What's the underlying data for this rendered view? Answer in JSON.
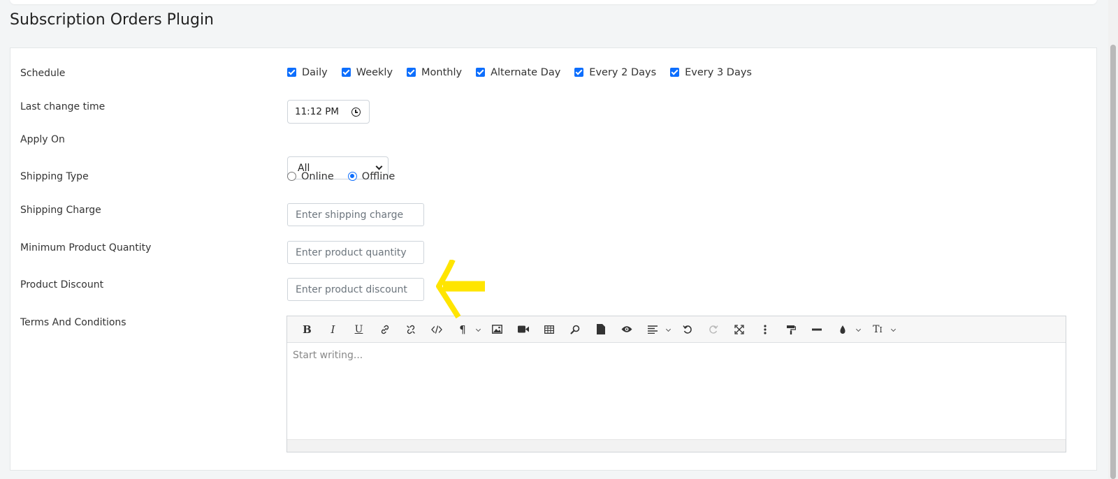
{
  "page": {
    "title": "Subscription Orders Plugin"
  },
  "form": {
    "schedule": {
      "label": "Schedule",
      "options": [
        {
          "label": "Daily",
          "checked": true
        },
        {
          "label": "Weekly",
          "checked": true
        },
        {
          "label": "Monthly",
          "checked": true
        },
        {
          "label": "Alternate Day",
          "checked": true
        },
        {
          "label": "Every 2 Days",
          "checked": true
        },
        {
          "label": "Every 3 Days",
          "checked": true
        }
      ]
    },
    "last_change_time": {
      "label": "Last change time",
      "value": "11:12 PM"
    },
    "apply_on": {
      "label": "Apply On",
      "value": "All"
    },
    "shipping_type": {
      "label": "Shipping Type",
      "options": [
        {
          "label": "Online",
          "selected": false
        },
        {
          "label": "Offline",
          "selected": true
        }
      ]
    },
    "shipping_charge": {
      "label": "Shipping Charge",
      "placeholder": "Enter shipping charge",
      "value": ""
    },
    "min_quantity": {
      "label": "Minimum Product Quantity",
      "placeholder": "Enter product quantity",
      "value": ""
    },
    "product_discount": {
      "label": "Product Discount",
      "placeholder": "Enter product discount",
      "value": ""
    },
    "terms": {
      "label": "Terms And Conditions",
      "placeholder": "Start writing...",
      "toolbar": [
        "bold",
        "italic",
        "underline",
        "link",
        "unlink",
        "code-view",
        "paragraph",
        "image",
        "video",
        "table",
        "find",
        "template",
        "preview",
        "align",
        "undo",
        "redo",
        "fullscreen",
        "more",
        "format-painter",
        "horizontal-rule",
        "text-color",
        "font-size"
      ]
    }
  },
  "colors": {
    "accent": "#0d6efd",
    "annotation": "#ffe500"
  }
}
